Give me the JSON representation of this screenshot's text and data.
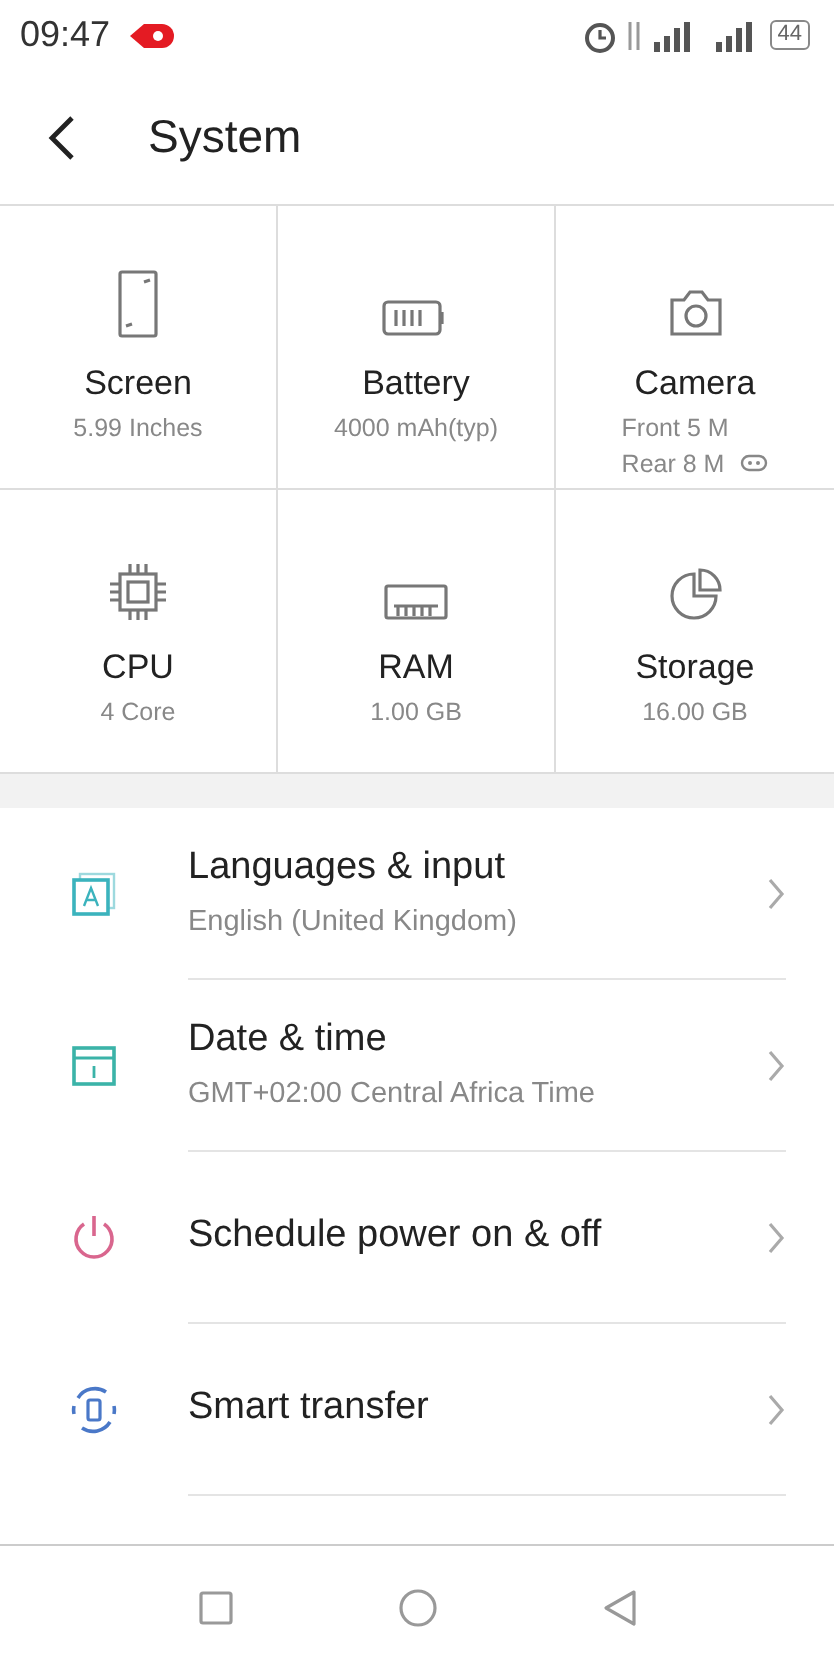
{
  "status_bar": {
    "time": "09:47",
    "battery": "44"
  },
  "header": {
    "title": "System"
  },
  "specs": [
    {
      "kind": "screen",
      "label": "Screen",
      "details": [
        "5.99 Inches"
      ]
    },
    {
      "kind": "battery",
      "label": "Battery",
      "details": [
        "4000 mAh(typ)"
      ]
    },
    {
      "kind": "camera",
      "label": "Camera",
      "details": [
        "Front 5 M",
        "Rear 8 M"
      ]
    },
    {
      "kind": "cpu",
      "label": "CPU",
      "details": [
        "4 Core"
      ]
    },
    {
      "kind": "ram",
      "label": "RAM",
      "details": [
        "1.00 GB"
      ]
    },
    {
      "kind": "storage",
      "label": "Storage",
      "details": [
        "16.00 GB"
      ]
    }
  ],
  "settings": [
    {
      "kind": "language",
      "color": "#3bb3bd",
      "title": "Languages & input",
      "subtitle": "English (United Kingdom)"
    },
    {
      "kind": "calendar",
      "color": "#3bb3a8",
      "title": "Date & time",
      "subtitle": "GMT+02:00 Central Africa Time"
    },
    {
      "kind": "power",
      "color": "#d9668e",
      "title": "Schedule power on & off"
    },
    {
      "kind": "transfer",
      "color": "#4a78c8",
      "title": "Smart transfer"
    }
  ]
}
